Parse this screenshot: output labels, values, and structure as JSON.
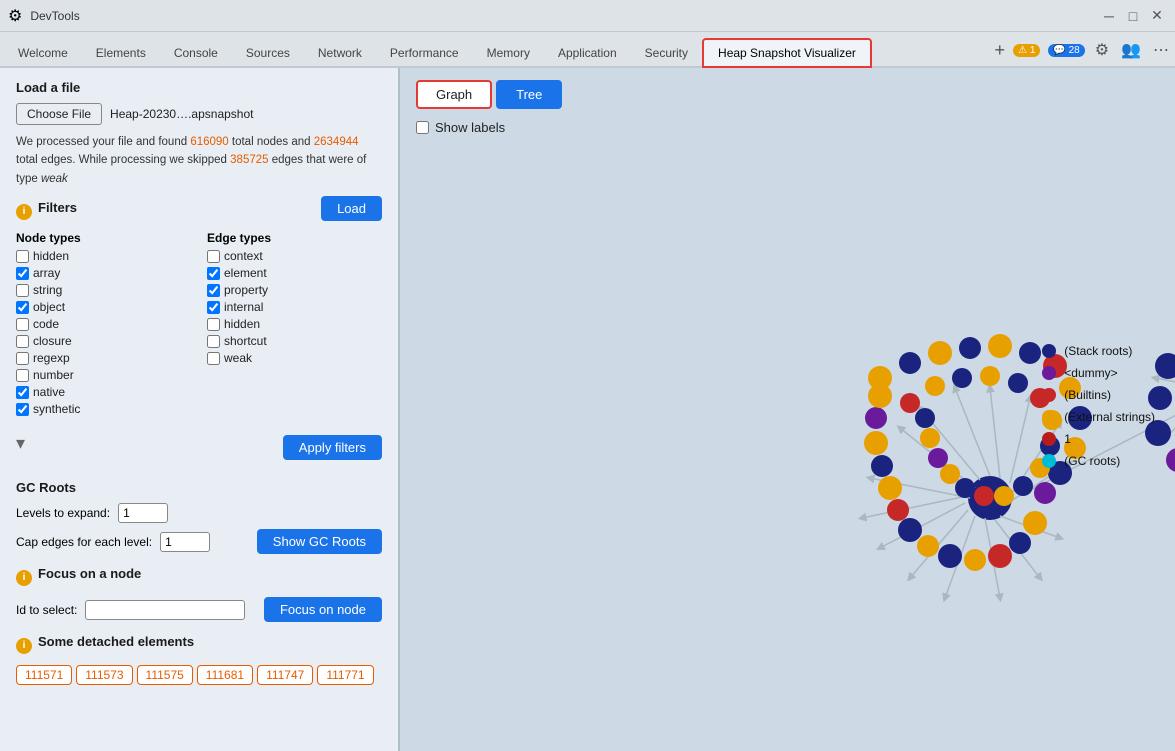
{
  "titleBar": {
    "title": "DevTools",
    "controls": [
      "─",
      "□",
      "✕"
    ]
  },
  "tabs": [
    {
      "id": "welcome",
      "label": "Welcome",
      "active": false
    },
    {
      "id": "elements",
      "label": "Elements",
      "active": false
    },
    {
      "id": "console",
      "label": "Console",
      "active": false
    },
    {
      "id": "sources",
      "label": "Sources",
      "active": false
    },
    {
      "id": "network",
      "label": "Network",
      "active": false
    },
    {
      "id": "performance",
      "label": "Performance",
      "active": false
    },
    {
      "id": "memory",
      "label": "Memory",
      "active": false
    },
    {
      "id": "application",
      "label": "Application",
      "active": false
    },
    {
      "id": "security",
      "label": "Security",
      "active": false
    },
    {
      "id": "heap-snapshot",
      "label": "Heap Snapshot Visualizer",
      "active": true,
      "highlighted": true
    }
  ],
  "tabBarRight": {
    "addTabLabel": "+",
    "badge1": {
      "icon": "⚠",
      "count": "1"
    },
    "badge2": {
      "icon": "💬",
      "count": "28"
    }
  },
  "leftPanel": {
    "fileSection": {
      "title": "Load a file",
      "chooseBtnLabel": "Choose File",
      "fileName": "Heap-20230….apsnapshot",
      "infoText": "We processed your file and found ",
      "totalNodes": "616090",
      "infoText2": " total nodes and ",
      "totalEdges": "2634944",
      "infoText3": " total edges. While processing we skipped ",
      "skippedEdges": "385725",
      "infoText4": " edges that were of type ",
      "weakType": "weak",
      "loadBtnLabel": "Load"
    },
    "filters": {
      "title": "Filters",
      "nodeTypes": {
        "title": "Node types",
        "items": [
          {
            "label": "hidden",
            "checked": false
          },
          {
            "label": "array",
            "checked": true
          },
          {
            "label": "string",
            "checked": false
          },
          {
            "label": "object",
            "checked": true
          },
          {
            "label": "code",
            "checked": false
          },
          {
            "label": "closure",
            "checked": false
          },
          {
            "label": "regexp",
            "checked": false
          },
          {
            "label": "number",
            "checked": false
          },
          {
            "label": "native",
            "checked": true
          },
          {
            "label": "synthetic",
            "checked": true
          }
        ]
      },
      "edgeTypes": {
        "title": "Edge types",
        "items": [
          {
            "label": "context",
            "checked": false
          },
          {
            "label": "element",
            "checked": true
          },
          {
            "label": "property",
            "checked": true
          },
          {
            "label": "internal",
            "checked": true
          },
          {
            "label": "hidden",
            "checked": false
          },
          {
            "label": "shortcut",
            "checked": false
          },
          {
            "label": "weak",
            "checked": false
          }
        ]
      },
      "applyBtnLabel": "Apply filters"
    },
    "gcRoots": {
      "title": "GC Roots",
      "levelsLabel": "Levels to expand:",
      "levelsValue": "1",
      "capLabel": "Cap edges for each level:",
      "capValue": "1",
      "showBtnLabel": "Show GC Roots"
    },
    "focusNode": {
      "title": "Focus on a node",
      "idLabel": "Id to select:",
      "idValue": "",
      "focusBtnLabel": "Focus on node"
    },
    "detached": {
      "title": "Some detached elements",
      "chips": [
        "111571",
        "111573",
        "111575",
        "111681",
        "111747",
        "111771"
      ]
    }
  },
  "rightPanel": {
    "graphTabLabel": "Graph",
    "treeTabLabel": "Tree",
    "activeTab": "Graph",
    "showLabelsLabel": "Show labels",
    "legend": [
      {
        "label": "(Stack roots)",
        "color": "#1a237e"
      },
      {
        "label": "<dummy>",
        "color": "#6a1a9a"
      },
      {
        "label": "(Builtins)",
        "color": "#c62828"
      },
      {
        "label": "(External strings)",
        "color": "#e8a000"
      },
      {
        "label": "1",
        "color": "#b71c1c"
      },
      {
        "label": "(GC roots)",
        "color": "#00bcd4"
      }
    ]
  }
}
